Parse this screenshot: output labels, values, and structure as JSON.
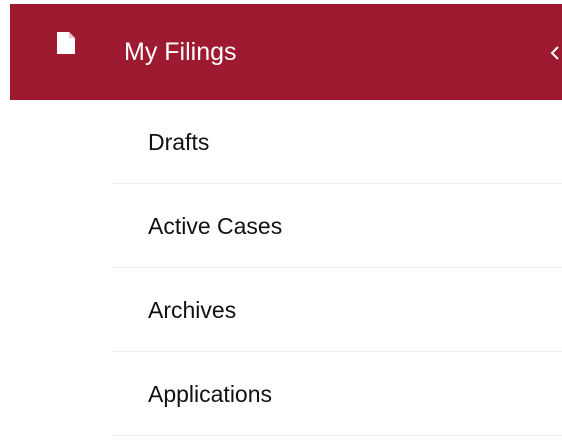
{
  "menu": {
    "header": {
      "label": "My Filings",
      "icon": "file-icon",
      "toggle_icon": "chevron-left-icon",
      "background": "#9e1a30",
      "text_color": "#ffffff"
    },
    "items": [
      {
        "label": "Drafts"
      },
      {
        "label": "Active Cases"
      },
      {
        "label": "Archives"
      },
      {
        "label": "Applications"
      }
    ]
  }
}
